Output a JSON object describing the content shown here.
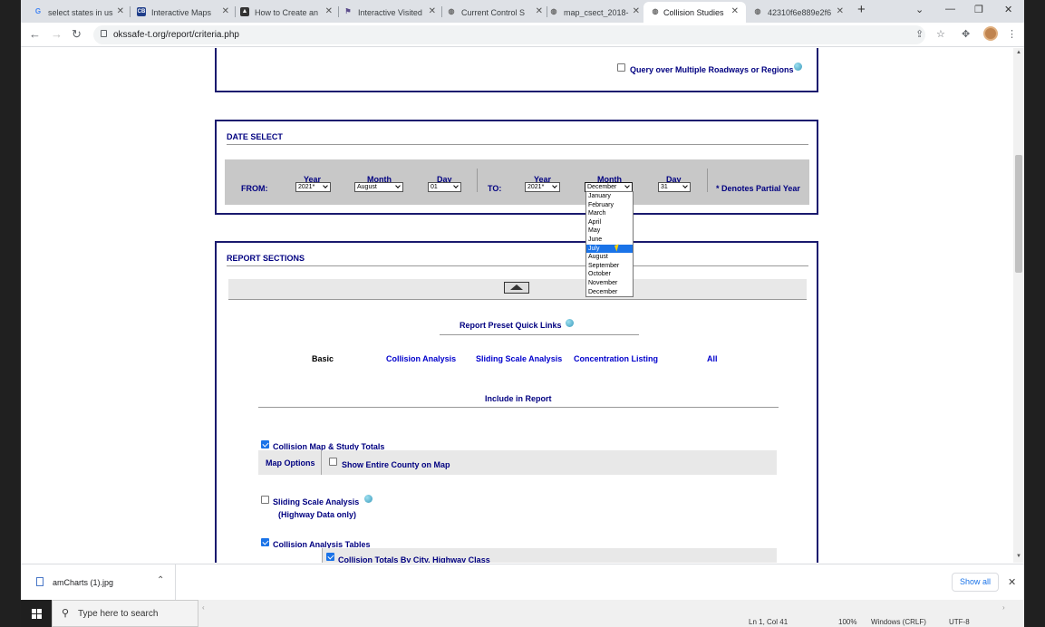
{
  "browser": {
    "tabs": [
      {
        "label": "select states in us",
        "icon": "google-icon",
        "active": false
      },
      {
        "label": "Interactive Maps",
        "icon": "cb-icon",
        "active": false
      },
      {
        "label": "How to Create an",
        "icon": "image-icon",
        "active": false
      },
      {
        "label": "Interactive Visited",
        "icon": "flag-icon",
        "active": false
      },
      {
        "label": "Current Control S",
        "icon": "globe-icon",
        "active": false
      },
      {
        "label": "map_csect_2018-",
        "icon": "globe-icon",
        "active": false
      },
      {
        "label": "Collision Studies",
        "icon": "globe-icon",
        "active": true
      },
      {
        "label": "42310f6e889e2f6",
        "icon": "globe-icon",
        "active": false
      }
    ],
    "url": "okssafe-t.org/report/criteria.php"
  },
  "query": {
    "multi_label": "Query over Multiple Roadways or Regions",
    "multi_checked": false
  },
  "date_select": {
    "title": "DATE SELECT",
    "from_label": "FROM:",
    "to_label": "TO:",
    "year_label": "Year",
    "month_label": "Month",
    "day_label": "Day",
    "from_year": "2021*",
    "from_month": "August",
    "from_day": "01",
    "to_year": "2021*",
    "to_month": "December",
    "to_day": "31",
    "partial_note": "* Denotes Partial Year"
  },
  "month_dropdown": {
    "options": [
      "January",
      "February",
      "March",
      "April",
      "May",
      "June",
      "July",
      "August",
      "September",
      "October",
      "November",
      "December"
    ],
    "highlighted": "July"
  },
  "report_sections": {
    "title": "REPORT SECTIONS",
    "preset_title": "Report Preset Quick Links",
    "presets": {
      "basic": "Basic",
      "collision": "Collision Analysis",
      "sliding": "Sliding Scale Analysis",
      "concentration": "Concentration Listing",
      "all": "All"
    },
    "include_title": "Include in Report",
    "items": {
      "map_totals": {
        "label": "Collision Map & Study Totals",
        "checked": true
      },
      "map_options": "Map Options",
      "entire_county": {
        "label": "Show Entire County on Map",
        "checked": false
      },
      "sliding": {
        "label": "Sliding Scale Analysis",
        "sub": "(Highway Data only)",
        "checked": false
      },
      "analysis_tables": {
        "label": "Collision Analysis Tables",
        "checked": true
      },
      "totals_city": {
        "label": "Collision Totals By City, Highway Class",
        "checked": true
      }
    }
  },
  "downloads": {
    "file": "amCharts (1).jpg",
    "show_all": "Show all"
  },
  "statusbar": {
    "pos": "Ln 1, Col 41",
    "zoom": "100%",
    "eol": "Windows (CRLF)",
    "enc": "UTF-8"
  },
  "taskbar": {
    "search_placeholder": "Type here to search"
  }
}
